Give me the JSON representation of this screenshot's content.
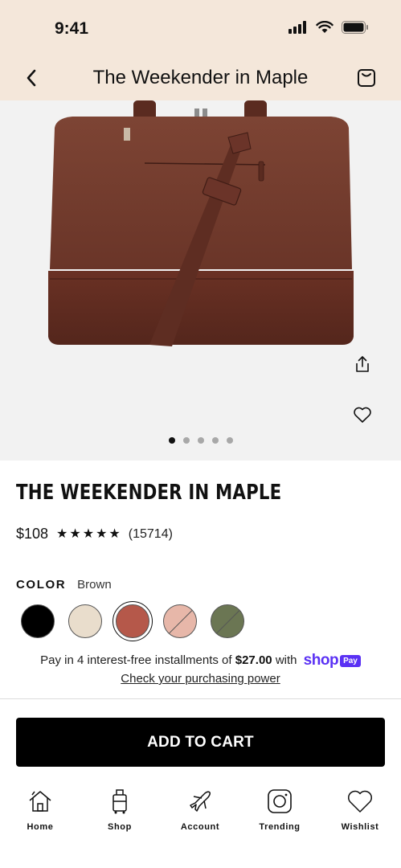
{
  "status_bar": {
    "time": "9:41"
  },
  "header": {
    "title": "The Weekender in Maple"
  },
  "gallery": {
    "image_count": 5,
    "active_index": 0
  },
  "product": {
    "name": "THE WEEKENDER IN MAPLE",
    "price": "$108",
    "rating": 5,
    "review_count": "(15714)",
    "color_label": "COLOR",
    "color_value": "Brown"
  },
  "swatches": [
    {
      "color": "#000000",
      "selected": false,
      "unavailable": false
    },
    {
      "color": "#e9ddcc",
      "selected": false,
      "unavailable": false
    },
    {
      "color": "#b5584a",
      "selected": true,
      "unavailable": false
    },
    {
      "color": "#e7b7a9",
      "selected": false,
      "unavailable": true
    },
    {
      "color": "#6b7653",
      "selected": false,
      "unavailable": true
    }
  ],
  "installments": {
    "prefix": "Pay in 4 interest-free installments of",
    "amount": "$27.00",
    "suffix": "with",
    "brand": "shop",
    "badge": "Pay",
    "link": "Check your purchasing power"
  },
  "cta": {
    "add_to_cart": "ADD TO CART"
  },
  "nav": {
    "items": [
      {
        "label": "Home",
        "icon": "home-icon"
      },
      {
        "label": "Shop",
        "icon": "luggage-icon"
      },
      {
        "label": "Account",
        "icon": "airplane-icon"
      },
      {
        "label": "Trending",
        "icon": "instagram-icon"
      },
      {
        "label": "Wishlist",
        "icon": "heart-icon"
      }
    ]
  },
  "colors": {
    "header_bg": "#f4e7da",
    "gallery_bg": "#f2f2f2",
    "shop_purple": "#5a31f4",
    "bag_brown": "#6e3a2c"
  }
}
